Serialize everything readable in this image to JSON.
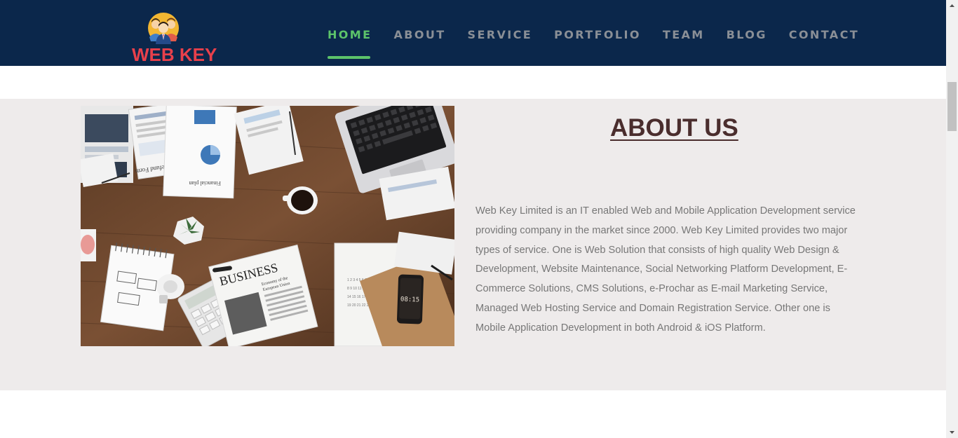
{
  "brand": {
    "name": "WEB KEY",
    "accent": "#e8404b"
  },
  "nav": {
    "items": [
      {
        "label": "HOME",
        "active": true
      },
      {
        "label": "ABOUT",
        "active": false
      },
      {
        "label": "SERVICE",
        "active": false
      },
      {
        "label": "PORTFOLIO",
        "active": false
      },
      {
        "label": "TEAM",
        "active": false
      },
      {
        "label": "BLOG",
        "active": false
      },
      {
        "label": "CONTACT",
        "active": false
      }
    ],
    "active_color": "#5cc36a",
    "background": "#0b274b"
  },
  "about": {
    "title": "ABOUT US",
    "body": "Web Key Limited is an IT enabled Web and Mobile Application Development service providing company in the market since 2000. Web Key Limited provides two major types of service. One is Web Solution that consists of high quality Web Design & Development, Website Maintenance, Social Networking Platform Development, E-Commerce Solutions, CMS Solutions, e-Prochar as E-mail Marketing Service, Managed Web Hosting Service and Domain Registration Service. Other one is Mobile Application Development in both Android & iOS Platform.",
    "photo": {
      "icon": "office-desk-photo",
      "documents": [
        "Tax Refund Form",
        "Financial plan",
        "BUSINESS",
        "Economy of the European Union"
      ],
      "phone_time": "08:15"
    }
  }
}
